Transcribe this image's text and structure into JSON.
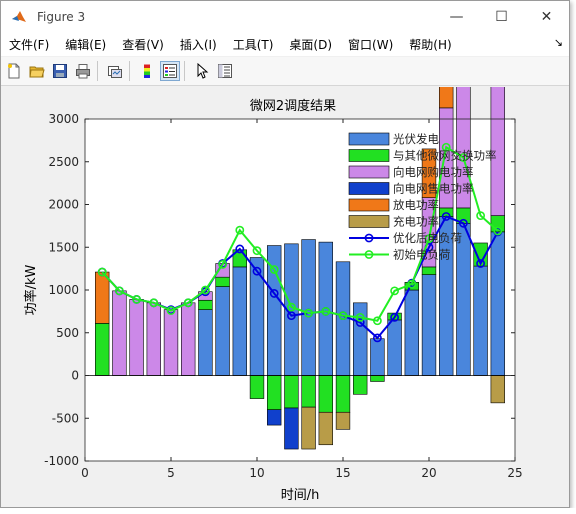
{
  "window": {
    "title": "Figure 3",
    "minimize": "—",
    "maximize": "☐",
    "close": "✕"
  },
  "menu": {
    "items": [
      "文件(F)",
      "编辑(E)",
      "查看(V)",
      "插入(I)",
      "工具(T)",
      "桌面(D)",
      "窗口(W)",
      "帮助(H)"
    ],
    "overflow": "↘"
  },
  "toolbar": {
    "buttons": [
      "new-figure-icon",
      "open-file-icon",
      "save-icon",
      "print-icon",
      "link-plot-icon",
      "colorbar-icon",
      "legend-icon",
      "pointer-icon",
      "property-editor-icon"
    ]
  },
  "colors": {
    "pv": "#4a86dc",
    "exchange": "#22e022",
    "buy": "#cc88e8",
    "sell": "#1040cc",
    "discharge": "#f07818",
    "charge": "#b89c48",
    "optimized_line": "#0000e0",
    "original_line": "#22ee22"
  },
  "chart_data": {
    "type": "bar",
    "title": "微网2调度结果",
    "xlabel": "时间/h",
    "ylabel": "功率/kW",
    "xlim": [
      0,
      25
    ],
    "ylim": [
      -1000,
      3000
    ],
    "xticks": [
      0,
      5,
      10,
      15,
      20,
      25
    ],
    "yticks": [
      -1000,
      -500,
      0,
      500,
      1000,
      1500,
      2000,
      2500,
      3000
    ],
    "grid": false,
    "legend_position": "top-right",
    "x": [
      1,
      2,
      3,
      4,
      5,
      6,
      7,
      8,
      9,
      10,
      11,
      12,
      13,
      14,
      15,
      16,
      17,
      18,
      19,
      20,
      21,
      22,
      23,
      24
    ],
    "bar_series": [
      {
        "name": "光伏发电",
        "color_key": "pv",
        "values": [
          0,
          0,
          0,
          0,
          0,
          0,
          770,
          1040,
          1270,
          1380,
          1520,
          1540,
          1590,
          1560,
          1330,
          850,
          430,
          650,
          1000,
          1180,
          1860,
          1780,
          1280,
          1680
        ]
      },
      {
        "name": "与其他微网交换功率",
        "color_key": "exchange",
        "values": [
          610,
          0,
          0,
          0,
          0,
          0,
          110,
          110,
          200,
          -270,
          -400,
          -380,
          -370,
          -430,
          -430,
          -220,
          -70,
          80,
          90,
          90,
          100,
          180,
          270,
          190
        ]
      },
      {
        "name": "向电网购电功率",
        "color_key": "buy",
        "values": [
          0,
          990,
          890,
          850,
          770,
          850,
          100,
          160,
          0,
          0,
          0,
          0,
          0,
          0,
          0,
          0,
          0,
          0,
          0,
          810,
          1170,
          1590,
          0,
          1790
        ]
      },
      {
        "name": "向电网售电功率",
        "color_key": "sell",
        "values": [
          0,
          0,
          0,
          0,
          0,
          0,
          0,
          0,
          0,
          0,
          -180,
          -480,
          0,
          0,
          0,
          0,
          0,
          0,
          0,
          0,
          0,
          0,
          0,
          0
        ]
      },
      {
        "name": "放电功率",
        "color_key": "discharge",
        "values": [
          600,
          0,
          0,
          0,
          0,
          0,
          0,
          0,
          0,
          0,
          0,
          0,
          0,
          0,
          0,
          0,
          0,
          0,
          0,
          570,
          610,
          0,
          0,
          0
        ]
      },
      {
        "name": "充电功率",
        "color_key": "charge",
        "values": [
          0,
          0,
          0,
          0,
          0,
          0,
          0,
          0,
          0,
          0,
          0,
          0,
          -490,
          -380,
          -200,
          0,
          0,
          0,
          0,
          0,
          0,
          0,
          0,
          -320
        ]
      }
    ],
    "line_series": [
      {
        "name": "优化后电负荷",
        "color_key": "optimized_line",
        "values": [
          1210,
          990,
          890,
          850,
          770,
          850,
          980,
          1310,
          1480,
          1220,
          960,
          700,
          730,
          750,
          700,
          620,
          440,
          680,
          1080,
          1500,
          1860,
          1780,
          1310,
          1680
        ]
      },
      {
        "name": "初始电负荷",
        "color_key": "original_line",
        "values": [
          1210,
          990,
          890,
          850,
          760,
          850,
          1000,
          1300,
          1700,
          1460,
          1240,
          800,
          730,
          750,
          700,
          680,
          640,
          990,
          1070,
          1600,
          2670,
          2550,
          1870,
          1690
        ]
      }
    ]
  }
}
